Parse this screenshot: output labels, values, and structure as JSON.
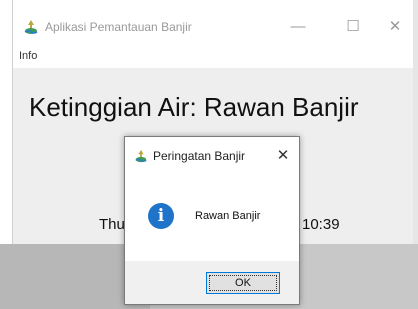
{
  "main_window": {
    "title": "Aplikasi Pemantauan Banjir",
    "minimize_glyph": "—",
    "maximize_glyph": "☐",
    "close_glyph": "✕",
    "icon": "app-icon"
  },
  "menu": {
    "items": [
      "Info"
    ]
  },
  "content": {
    "water_level": "Ketinggian Air: Rawan Banjir",
    "datetime_left": "Thu",
    "datetime_right": "10:39"
  },
  "dialog": {
    "title": "Peringatan Banjir",
    "close_glyph": "✕",
    "icon": "info-icon",
    "icon_glyph": "i",
    "message": "Rawan Banjir",
    "ok_label": "OK"
  },
  "colors": {
    "info_icon": "#1f73c8",
    "focus_border": "#0078d7"
  }
}
